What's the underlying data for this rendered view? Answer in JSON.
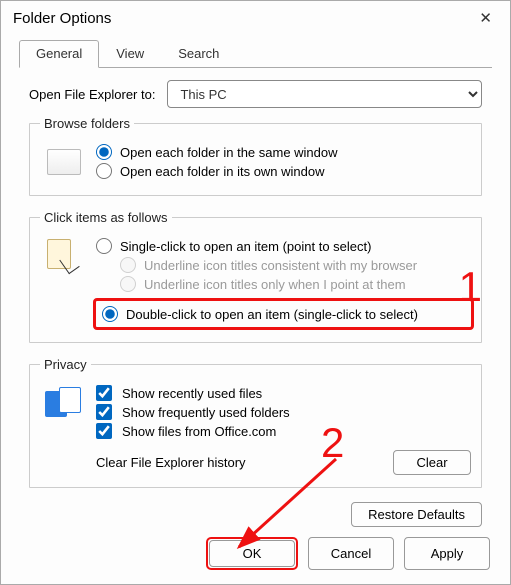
{
  "title": "Folder Options",
  "tabs": {
    "general": "General",
    "view": "View",
    "search": "Search"
  },
  "openExplorer": {
    "label": "Open File Explorer to:",
    "value": "This PC"
  },
  "browse": {
    "legend": "Browse folders",
    "same": "Open each folder in the same window",
    "own": "Open each folder in its own window"
  },
  "click": {
    "legend": "Click items as follows",
    "single": "Single-click to open an item (point to select)",
    "underlineBrowser": "Underline icon titles consistent with my browser",
    "underlinePoint": "Underline icon titles only when I point at them",
    "double": "Double-click to open an item (single-click to select)"
  },
  "privacy": {
    "legend": "Privacy",
    "recent": "Show recently used files",
    "frequent": "Show frequently used folders",
    "office": "Show files from Office.com",
    "clearLabel": "Clear File Explorer history",
    "clearBtn": "Clear"
  },
  "restore": "Restore Defaults",
  "buttons": {
    "ok": "OK",
    "cancel": "Cancel",
    "apply": "Apply"
  },
  "annotations": {
    "one": "1",
    "two": "2"
  }
}
